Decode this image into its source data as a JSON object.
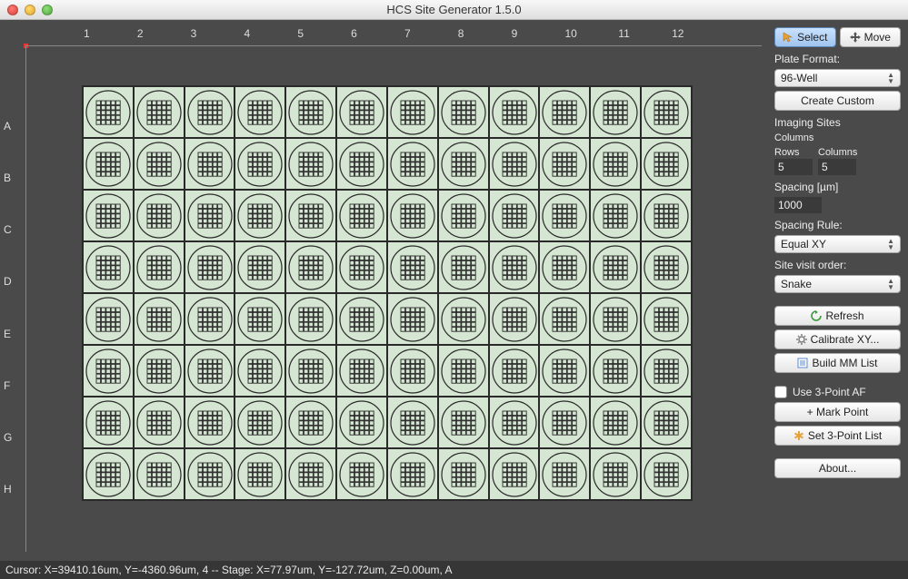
{
  "window": {
    "title": "HCS Site Generator 1.5.0"
  },
  "plate": {
    "columns": [
      "1",
      "2",
      "3",
      "4",
      "5",
      "6",
      "7",
      "8",
      "9",
      "10",
      "11",
      "12"
    ],
    "rows": [
      "A",
      "B",
      "C",
      "D",
      "E",
      "F",
      "G",
      "H"
    ]
  },
  "panel": {
    "select_btn": "Select",
    "move_btn": "Move",
    "plate_format_label": "Plate Format:",
    "plate_format_value": "96-Well",
    "create_custom": "Create Custom",
    "imaging_sites": "Imaging Sites",
    "columns_label": "Columns",
    "rows_label": "Rows",
    "rows_value": "5",
    "cols_value": "5",
    "spacing_label": "Spacing [µm]",
    "spacing_value": "1000",
    "spacing_rule_label": "Spacing Rule:",
    "spacing_rule_value": "Equal XY",
    "visit_order_label": "Site visit order:",
    "visit_order_value": "Snake",
    "refresh": "Refresh",
    "calibrate": "Calibrate XY...",
    "build_mm": "Build MM List",
    "use_3pt": "Use 3-Point AF",
    "mark_point": "+ Mark Point",
    "set_3pt": "Set 3-Point List",
    "about": "About..."
  },
  "status": {
    "text": "Cursor: X=39410.16um, Y=-4360.96um, 4 -- Stage: X=77.97um, Y=-127.72um, Z=0.00um, A"
  }
}
